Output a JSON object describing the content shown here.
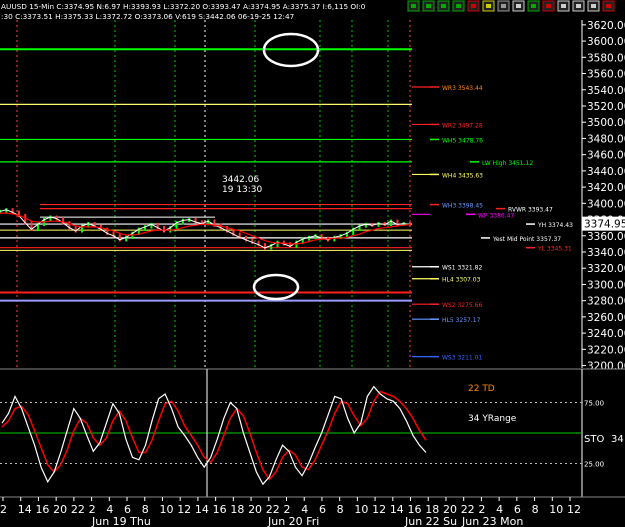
{
  "header": {
    "line1": "AUUSD 15-Min C:3374.95 N:6.97 H:3393.93 L:3372.20 O:3393.47 A:3374.95 A:3375.37 I:6,115 OI:0",
    "line2": ":30 C:3373.51 H:3375.33 L:3372.72 O:3373.06 V:619 S:3442.06 06-19-25 12:47"
  },
  "toolbar_icons": [
    "flag-icon",
    "add-icon",
    "up-icon",
    "down-icon",
    "close-icon",
    "crosshair-icon",
    "grid-icon",
    "cursor-icon",
    "add-icon",
    "close-icon",
    "window-icon",
    "minimize-icon",
    "restore-icon",
    "close-icon"
  ],
  "colors": {
    "background": "#000000",
    "price_line": "#ffffff",
    "ma_red": "#ff0000",
    "ma_yellow": "#ffff66",
    "green_level": "#00ff00",
    "yellow_level": "#ffff66",
    "red_level": "#ff2020",
    "blue_level": "#9999ff",
    "orange_label": "#ff8800"
  },
  "chart_data": [
    {
      "type": "line",
      "panel": "price",
      "y_ticks": [
        "3620.00",
        "3600.00",
        "3580.00",
        "3560.00",
        "3540.00",
        "3520.00",
        "3500.00",
        "3480.00",
        "3460.00",
        "3440.00",
        "3420.00",
        "3400.00",
        "3380.00",
        "3360.00",
        "3340.00",
        "3320.00",
        "3300.00",
        "3280.00",
        "3260.00",
        "3240.00",
        "3220.00",
        "3200.00"
      ],
      "ylim": [
        3197,
        3626
      ],
      "current_price": "3374.95",
      "price_close": [
        3390,
        3392,
        3389,
        3385,
        3376,
        3368,
        3374,
        3380,
        3383,
        3381,
        3376,
        3370,
        3366,
        3372,
        3375,
        3372,
        3368,
        3363,
        3360,
        3355,
        3358,
        3363,
        3368,
        3371,
        3374,
        3370,
        3366,
        3370,
        3376,
        3379,
        3380,
        3377,
        3375,
        3378,
        3373,
        3370,
        3366,
        3362,
        3358,
        3355,
        3352,
        3349,
        3345,
        3348,
        3352,
        3350,
        3347,
        3352,
        3356,
        3358,
        3360,
        3357,
        3355,
        3358,
        3360,
        3363,
        3368,
        3372,
        3374,
        3373,
        3375,
        3374,
        3378,
        3374,
        3375,
        3374
      ],
      "ma_red": [
        3388,
        3388,
        3387,
        3385,
        3382,
        3378,
        3377,
        3377,
        3378,
        3378,
        3377,
        3375,
        3372,
        3371,
        3371,
        3371,
        3370,
        3368,
        3366,
        3363,
        3361,
        3361,
        3362,
        3364,
        3366,
        3367,
        3367,
        3367,
        3368,
        3370,
        3372,
        3373,
        3374,
        3374,
        3373,
        3372,
        3370,
        3368,
        3366,
        3363,
        3360,
        3357,
        3354,
        3352,
        3351,
        3351,
        3350,
        3350,
        3351,
        3353,
        3355,
        3356,
        3356,
        3357,
        3357,
        3358,
        3360,
        3362,
        3365,
        3367,
        3369,
        3370,
        3371,
        3372,
        3373,
        3374
      ],
      "levels": [
        {
          "price": 3590,
          "color": "#00ff00",
          "label": "",
          "label_color": "#00ff00"
        },
        {
          "price": 3543.44,
          "color": "#ff2020",
          "label": "WR3 3543.44",
          "label_color": "#ff8800"
        },
        {
          "price": 3522,
          "color": "#ffff66",
          "label": "",
          "label_color": "#ffff66"
        },
        {
          "price": 3497.28,
          "color": "#ff2020",
          "label": "WR2 3497.28",
          "label_color": "#ff2020"
        },
        {
          "price": 3478.76,
          "color": "#00ff00",
          "label": "WH5 3478.76",
          "label_color": "#00ff00"
        },
        {
          "price": 3451.12,
          "color": "#00ff00",
          "label": "LW High 3451.12",
          "label_color": "#00ff00"
        },
        {
          "price": 3435.63,
          "color": "#ffff66",
          "label": "WH4 3435.63",
          "label_color": "#ffff66"
        },
        {
          "price": 3398.45,
          "color": "#ff2020",
          "label": "WH3 3398.45",
          "label_color": "#6699ff"
        },
        {
          "price": 3393.47,
          "color": "#ff2020",
          "label": "RVWR 3393.47",
          "label_color": "#ffffff"
        },
        {
          "price": 3386.47,
          "color": "#ff00ff",
          "label": "WP 3386.47",
          "label_color": "#ff00ff"
        },
        {
          "price": 3374.43,
          "color": "#ffffff",
          "label": "YH 3374.43",
          "label_color": "#ffffff"
        },
        {
          "price": 3357.37,
          "color": "#ffffff",
          "label": "Yest Mid Point 3357.37",
          "label_color": "#ffffff"
        },
        {
          "price": 3345.31,
          "color": "#ff2020",
          "label": "YL 3345.31",
          "label_color": "#ff2020"
        },
        {
          "price": 3321.82,
          "color": "#ffffff",
          "label": "WS1 3321.82",
          "label_color": "#ffffff"
        },
        {
          "price": 3307.03,
          "color": "#ffff66",
          "label": "HL4 3307.03",
          "label_color": "#ffff66"
        },
        {
          "price": 3290,
          "color": "#ff2020",
          "label": "",
          "label_color": "#ff2020"
        },
        {
          "price": 3280,
          "color": "#9999ff",
          "label": "",
          "label_color": "#9999ff"
        },
        {
          "price": 3275.66,
          "color": "#ff2020",
          "label": "WS2 3275.66",
          "label_color": "#ff2020"
        },
        {
          "price": 3257.17,
          "color": "#6699ff",
          "label": "HL5 3257.17",
          "label_color": "#6699ff"
        },
        {
          "price": 3211.01,
          "color": "#3366ff",
          "label": "WS3 3211.01",
          "label_color": "#3366ff"
        }
      ],
      "annotation": {
        "line1": "3442.06",
        "line2": "19 13:30"
      }
    },
    {
      "type": "line",
      "panel": "oscillator",
      "ylim": [
        0,
        100
      ],
      "y_ticks": [
        "75.00",
        "25.00"
      ],
      "indicator_label": "STO",
      "indicator_value": "34",
      "labels": {
        "td": "22 TD",
        "yrange": "34 YRange"
      },
      "stoch_k": [
        58,
        66,
        80,
        70,
        55,
        40,
        22,
        10,
        18,
        34,
        52,
        70,
        62,
        48,
        35,
        42,
        58,
        74,
        66,
        45,
        30,
        28,
        40,
        60,
        78,
        82,
        70,
        55,
        48,
        40,
        30,
        22,
        30,
        45,
        62,
        75,
        70,
        50,
        34,
        18,
        8,
        14,
        28,
        40,
        35,
        22,
        15,
        25,
        38,
        50,
        65,
        80,
        78,
        62,
        50,
        58,
        80,
        88,
        82,
        78,
        76,
        70,
        60,
        48,
        40,
        34
      ],
      "stoch_d": [
        55,
        60,
        70,
        72,
        65,
        52,
        38,
        24,
        18,
        24,
        36,
        52,
        62,
        58,
        46,
        40,
        46,
        60,
        68,
        60,
        46,
        34,
        34,
        44,
        60,
        74,
        76,
        68,
        56,
        48,
        40,
        30,
        26,
        34,
        48,
        62,
        70,
        64,
        50,
        34,
        20,
        12,
        18,
        30,
        36,
        32,
        22,
        20,
        28,
        40,
        52,
        66,
        76,
        74,
        64,
        56,
        62,
        76,
        84,
        82,
        80,
        76,
        70,
        62,
        52,
        44
      ],
      "levels": [
        75,
        50,
        25
      ]
    }
  ],
  "x_axis": {
    "hour_ticks": [
      "2",
      "14",
      "16",
      "20",
      "22",
      "2",
      "4",
      "6",
      "8",
      "10",
      "12",
      "14",
      "16",
      "18",
      "20",
      "22",
      "2",
      "4",
      "6",
      "8",
      "10",
      "12",
      "14",
      "16",
      "18",
      "20",
      "22",
      "2",
      "4",
      "6",
      "8",
      "10",
      "12"
    ],
    "day_labels": [
      "Jun 19 Thu",
      "Jun 20 Fri",
      "Jun 22 Su",
      "Jun 23 Mon"
    ]
  }
}
